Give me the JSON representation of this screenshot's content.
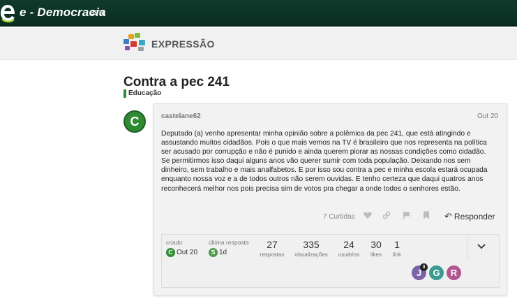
{
  "brand": {
    "name": "e - Democracia",
    "badge": "BETA",
    "color": "#0f3a2c"
  },
  "section": {
    "title": "EXPRESSÃO"
  },
  "topic": {
    "title": "Contra a pec 241",
    "category": "Educação",
    "category_color": "#2e8b3e"
  },
  "post": {
    "avatar_letter": "C",
    "author": "castelane62",
    "date": "Out 20",
    "body": "Deputado (a) venho apresentar minha opinião sobre a polêmica da pec 241, que está atingindo e assustando muitos cidadãos. Pois o que mais vemos na TV é brasileiro que nos representa na política ser acusado por corrupção e não é punido e ainda querem piorar as nossas condições como cidadão. Se permitirmos isso daqui alguns anos vão querer sumir com toda população. Deixando nos sem dinheiro, sem trabalho e mais analfabetos. E por isso sou contra a pec e minha escola estará ocupada enquanto nossa voz e a de todos outros não serem ouvidas. E tenho certeza que daqui quatros anos reconhecerá melhor nos pois precisa sim de votos pra chegar a onde todos o senhores estão.",
    "likes_label": "7 Curtidas",
    "reply_label": "Responder",
    "icons": [
      "heart-icon",
      "link-icon",
      "flag-icon",
      "bookmark-icon",
      "reply-icon"
    ]
  },
  "stats": {
    "created_label": "criado",
    "created_avatar": "C",
    "created_value": "Out 20",
    "last_reply_label": "última resposta",
    "last_reply_avatar": "S",
    "last_reply_value": "1d",
    "replies": {
      "value": "27",
      "label": "respostas"
    },
    "views": {
      "value": "335",
      "label": "visualizações"
    },
    "users": {
      "value": "24",
      "label": "usuários"
    },
    "likes": {
      "value": "30",
      "label": "likes"
    },
    "links": {
      "value": "1",
      "label": "link"
    },
    "participants": [
      {
        "letter": "J",
        "color": "#7b63a8",
        "badge": "3"
      },
      {
        "letter": "G",
        "color": "#3a9c90"
      },
      {
        "letter": "R",
        "color": "#b0578f"
      }
    ]
  },
  "colors": {
    "avatar_c": "#2f8a33",
    "avatar_s": "#4a9a4a"
  }
}
